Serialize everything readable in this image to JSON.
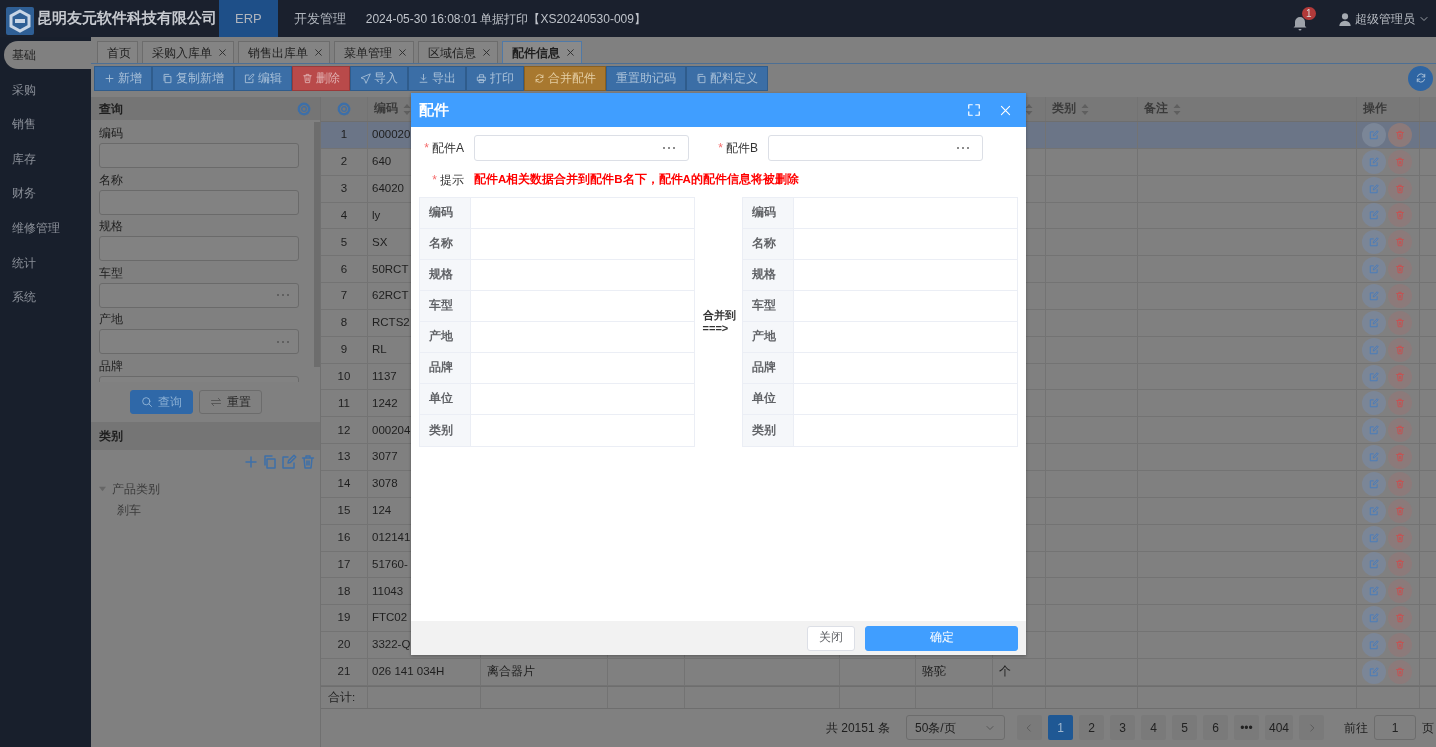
{
  "header": {
    "company": "昆明友元软件科技有限公司",
    "nav": [
      {
        "label": "ERP",
        "selected": true
      },
      {
        "label": "开发管理",
        "selected": false
      }
    ],
    "notice": "2024-05-30 16:08:01 单据打印【XS20240530-009】",
    "notification_count": "1",
    "user": "超级管理员"
  },
  "sidebar": {
    "items": [
      {
        "label": "基础",
        "selected": true
      },
      {
        "label": "采购",
        "selected": false
      },
      {
        "label": "销售",
        "selected": false
      },
      {
        "label": "库存",
        "selected": false
      },
      {
        "label": "财务",
        "selected": false
      },
      {
        "label": "维修管理",
        "selected": false
      },
      {
        "label": "统计",
        "selected": false
      },
      {
        "label": "系统",
        "selected": false
      }
    ]
  },
  "tabs": [
    {
      "label": "首页",
      "closable": false,
      "selected": false
    },
    {
      "label": "采购入库单",
      "closable": true,
      "selected": false
    },
    {
      "label": "销售出库单",
      "closable": true,
      "selected": false
    },
    {
      "label": "菜单管理",
      "closable": true,
      "selected": false
    },
    {
      "label": "区域信息",
      "closable": true,
      "selected": false
    },
    {
      "label": "配件信息",
      "closable": true,
      "selected": true
    }
  ],
  "toolbar": [
    {
      "label": "新增",
      "kind": "add"
    },
    {
      "label": "复制新增",
      "kind": "copy"
    },
    {
      "label": "编辑",
      "kind": "edit"
    },
    {
      "label": "删除",
      "kind": "delete"
    },
    {
      "label": "导入",
      "kind": "import"
    },
    {
      "label": "导出",
      "kind": "export"
    },
    {
      "label": "打印",
      "kind": "print"
    },
    {
      "label": "合并配件",
      "kind": "merge"
    },
    {
      "label": "重置助记码",
      "kind": "plain"
    },
    {
      "label": "配料定义",
      "kind": "copy"
    }
  ],
  "query": {
    "title": "查询",
    "fields": [
      {
        "label": "编码",
        "kind": "text"
      },
      {
        "label": "名称",
        "kind": "text"
      },
      {
        "label": "规格",
        "kind": "text"
      },
      {
        "label": "车型",
        "kind": "picker"
      },
      {
        "label": "产地",
        "kind": "picker"
      },
      {
        "label": "品牌",
        "kind": "text"
      }
    ],
    "buttons": [
      {
        "label": "查询",
        "kind": "search"
      },
      {
        "label": "重置",
        "kind": "reset"
      }
    ]
  },
  "category": {
    "title": "类别",
    "tree": [
      {
        "label": "产品类别",
        "expanded": true,
        "children": [
          {
            "label": "刹车"
          }
        ]
      }
    ]
  },
  "table": {
    "columns": [
      {
        "label": "编码",
        "sortable": true
      },
      {},
      {},
      {},
      {},
      {},
      {
        "sortable": true
      },
      {
        "label": "类别",
        "sortable": true
      },
      {
        "label": "备注",
        "sortable": true
      },
      {
        "label": "操作",
        "sortable": false
      }
    ],
    "rows": [
      {
        "index": "1",
        "selected": true,
        "cells": [
          "000020"
        ]
      },
      {
        "index": "2",
        "selected": false,
        "cells": [
          "640"
        ]
      },
      {
        "index": "3",
        "selected": false,
        "cells": [
          "64020"
        ]
      },
      {
        "index": "4",
        "selected": false,
        "cells": [
          "ly"
        ]
      },
      {
        "index": "5",
        "selected": false,
        "cells": [
          "SX"
        ]
      },
      {
        "index": "6",
        "selected": false,
        "cells": [
          "50RCT"
        ]
      },
      {
        "index": "7",
        "selected": false,
        "cells": [
          "62RCT"
        ]
      },
      {
        "index": "8",
        "selected": false,
        "cells": [
          "RCTS2"
        ]
      },
      {
        "index": "9",
        "selected": false,
        "cells": [
          "RL"
        ]
      },
      {
        "index": "10",
        "selected": false,
        "cells": [
          "1137"
        ]
      },
      {
        "index": "11",
        "selected": false,
        "cells": [
          "1242"
        ]
      },
      {
        "index": "12",
        "selected": false,
        "cells": [
          "000204"
        ]
      },
      {
        "index": "13",
        "selected": false,
        "cells": [
          "3077"
        ]
      },
      {
        "index": "14",
        "selected": false,
        "cells": [
          "3078"
        ]
      },
      {
        "index": "15",
        "selected": false,
        "cells": [
          "124"
        ]
      },
      {
        "index": "16",
        "selected": false,
        "cells": [
          "012141"
        ]
      },
      {
        "index": "17",
        "selected": false,
        "cells": [
          "51760-"
        ]
      },
      {
        "index": "18",
        "selected": false,
        "cells": [
          "11043"
        ]
      },
      {
        "index": "19",
        "selected": false,
        "cells": [
          "FTC02"
        ]
      },
      {
        "index": "20",
        "selected": false,
        "cells": [
          "3322-Q"
        ]
      },
      {
        "index": "21",
        "selected": false,
        "cells": [
          "026 141 034H",
          "离合器片",
          null,
          null,
          null,
          "骆驼",
          "个"
        ]
      }
    ],
    "total_label": "合计:"
  },
  "pagination": {
    "total": "共 20151 条",
    "page_size": "50条/页",
    "pages": [
      {
        "label": "1",
        "selected": true
      },
      {
        "label": "2",
        "selected": false
      },
      {
        "label": "3",
        "selected": false
      },
      {
        "label": "4",
        "selected": false
      },
      {
        "label": "5",
        "selected": false
      },
      {
        "label": "6",
        "selected": false
      },
      {
        "label": "•••",
        "selected": false
      },
      {
        "label": "404",
        "selected": false
      }
    ],
    "goto_label": "前往",
    "goto_value": "1",
    "goto_suffix": "页"
  },
  "dialog": {
    "title": "配件",
    "fields": [
      {
        "label": "配件A",
        "required_mark": "*"
      },
      {
        "label": "配件B",
        "required_mark": "*"
      }
    ],
    "hint": {
      "label": "提示",
      "required_mark": "*",
      "text": "配件A相关数据合并到配件B名下，配件A的配件信息将被删除"
    },
    "left_rows": [
      "编码",
      "名称",
      "规格",
      "车型",
      "产地",
      "品牌",
      "单位",
      "类别"
    ],
    "merge_label": "合并到",
    "arrow": "===>",
    "right_rows": [
      "编码",
      "名称",
      "规格",
      "车型",
      "产地",
      "品牌",
      "单位",
      "类别"
    ],
    "buttons": [
      {
        "label": "关闭",
        "kind": "secondary"
      },
      {
        "label": "确定",
        "kind": "primary"
      }
    ]
  }
}
